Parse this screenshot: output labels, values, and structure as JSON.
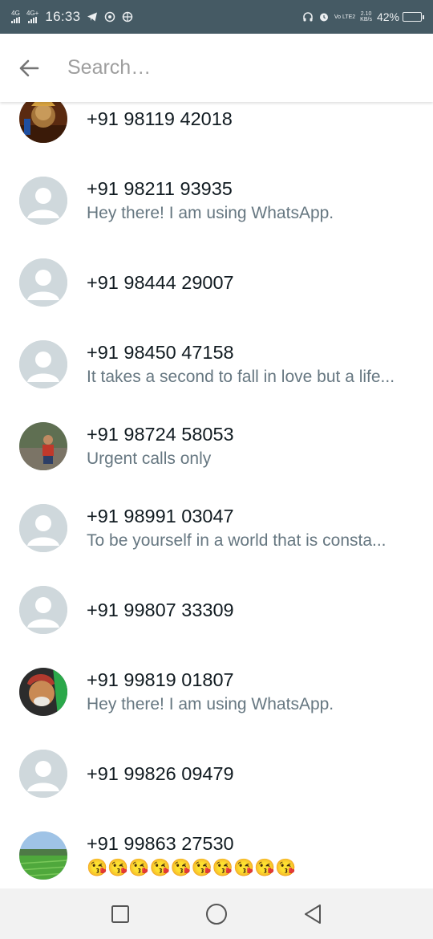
{
  "status_bar": {
    "net1": "4G",
    "net2": "4G+",
    "time": "16:33",
    "volte": "Vo LTE2",
    "speed": "2.10",
    "speed_unit": "KB/s",
    "battery": "42%",
    "battery_level": 0.42
  },
  "search": {
    "placeholder": "Search…"
  },
  "contacts": [
    {
      "name": "+91 98119 42018",
      "about": "",
      "avatar": "photo-deity"
    },
    {
      "name": "+91 98211 93935",
      "about": "Hey there! I am using WhatsApp.",
      "avatar": "default"
    },
    {
      "name": "+91 98444 29007",
      "about": "",
      "avatar": "default"
    },
    {
      "name": "+91 98450 47158",
      "about": "It takes a second to fall in love but a life...",
      "avatar": "default"
    },
    {
      "name": "+91 98724 58053",
      "about": "Urgent calls only",
      "avatar": "photo-person"
    },
    {
      "name": "+91 98991 03047",
      "about": "To be yourself in a world that is consta...",
      "avatar": "default"
    },
    {
      "name": "+91 99807 33309",
      "about": "",
      "avatar": "default"
    },
    {
      "name": "+91 99819 01807",
      "about": "Hey there! I am using WhatsApp.",
      "avatar": "photo-saint"
    },
    {
      "name": "+91 99826 09479",
      "about": "",
      "avatar": "default"
    },
    {
      "name": "+91 99863 27530",
      "about": "😘😘😘😘😘😘😘😘😘😘",
      "avatar": "photo-field"
    }
  ],
  "colors": {
    "status_bar": "#455a64",
    "default_avatar_bg": "#cfd8dc",
    "name_text": "#111b21",
    "about_text": "#667781"
  }
}
